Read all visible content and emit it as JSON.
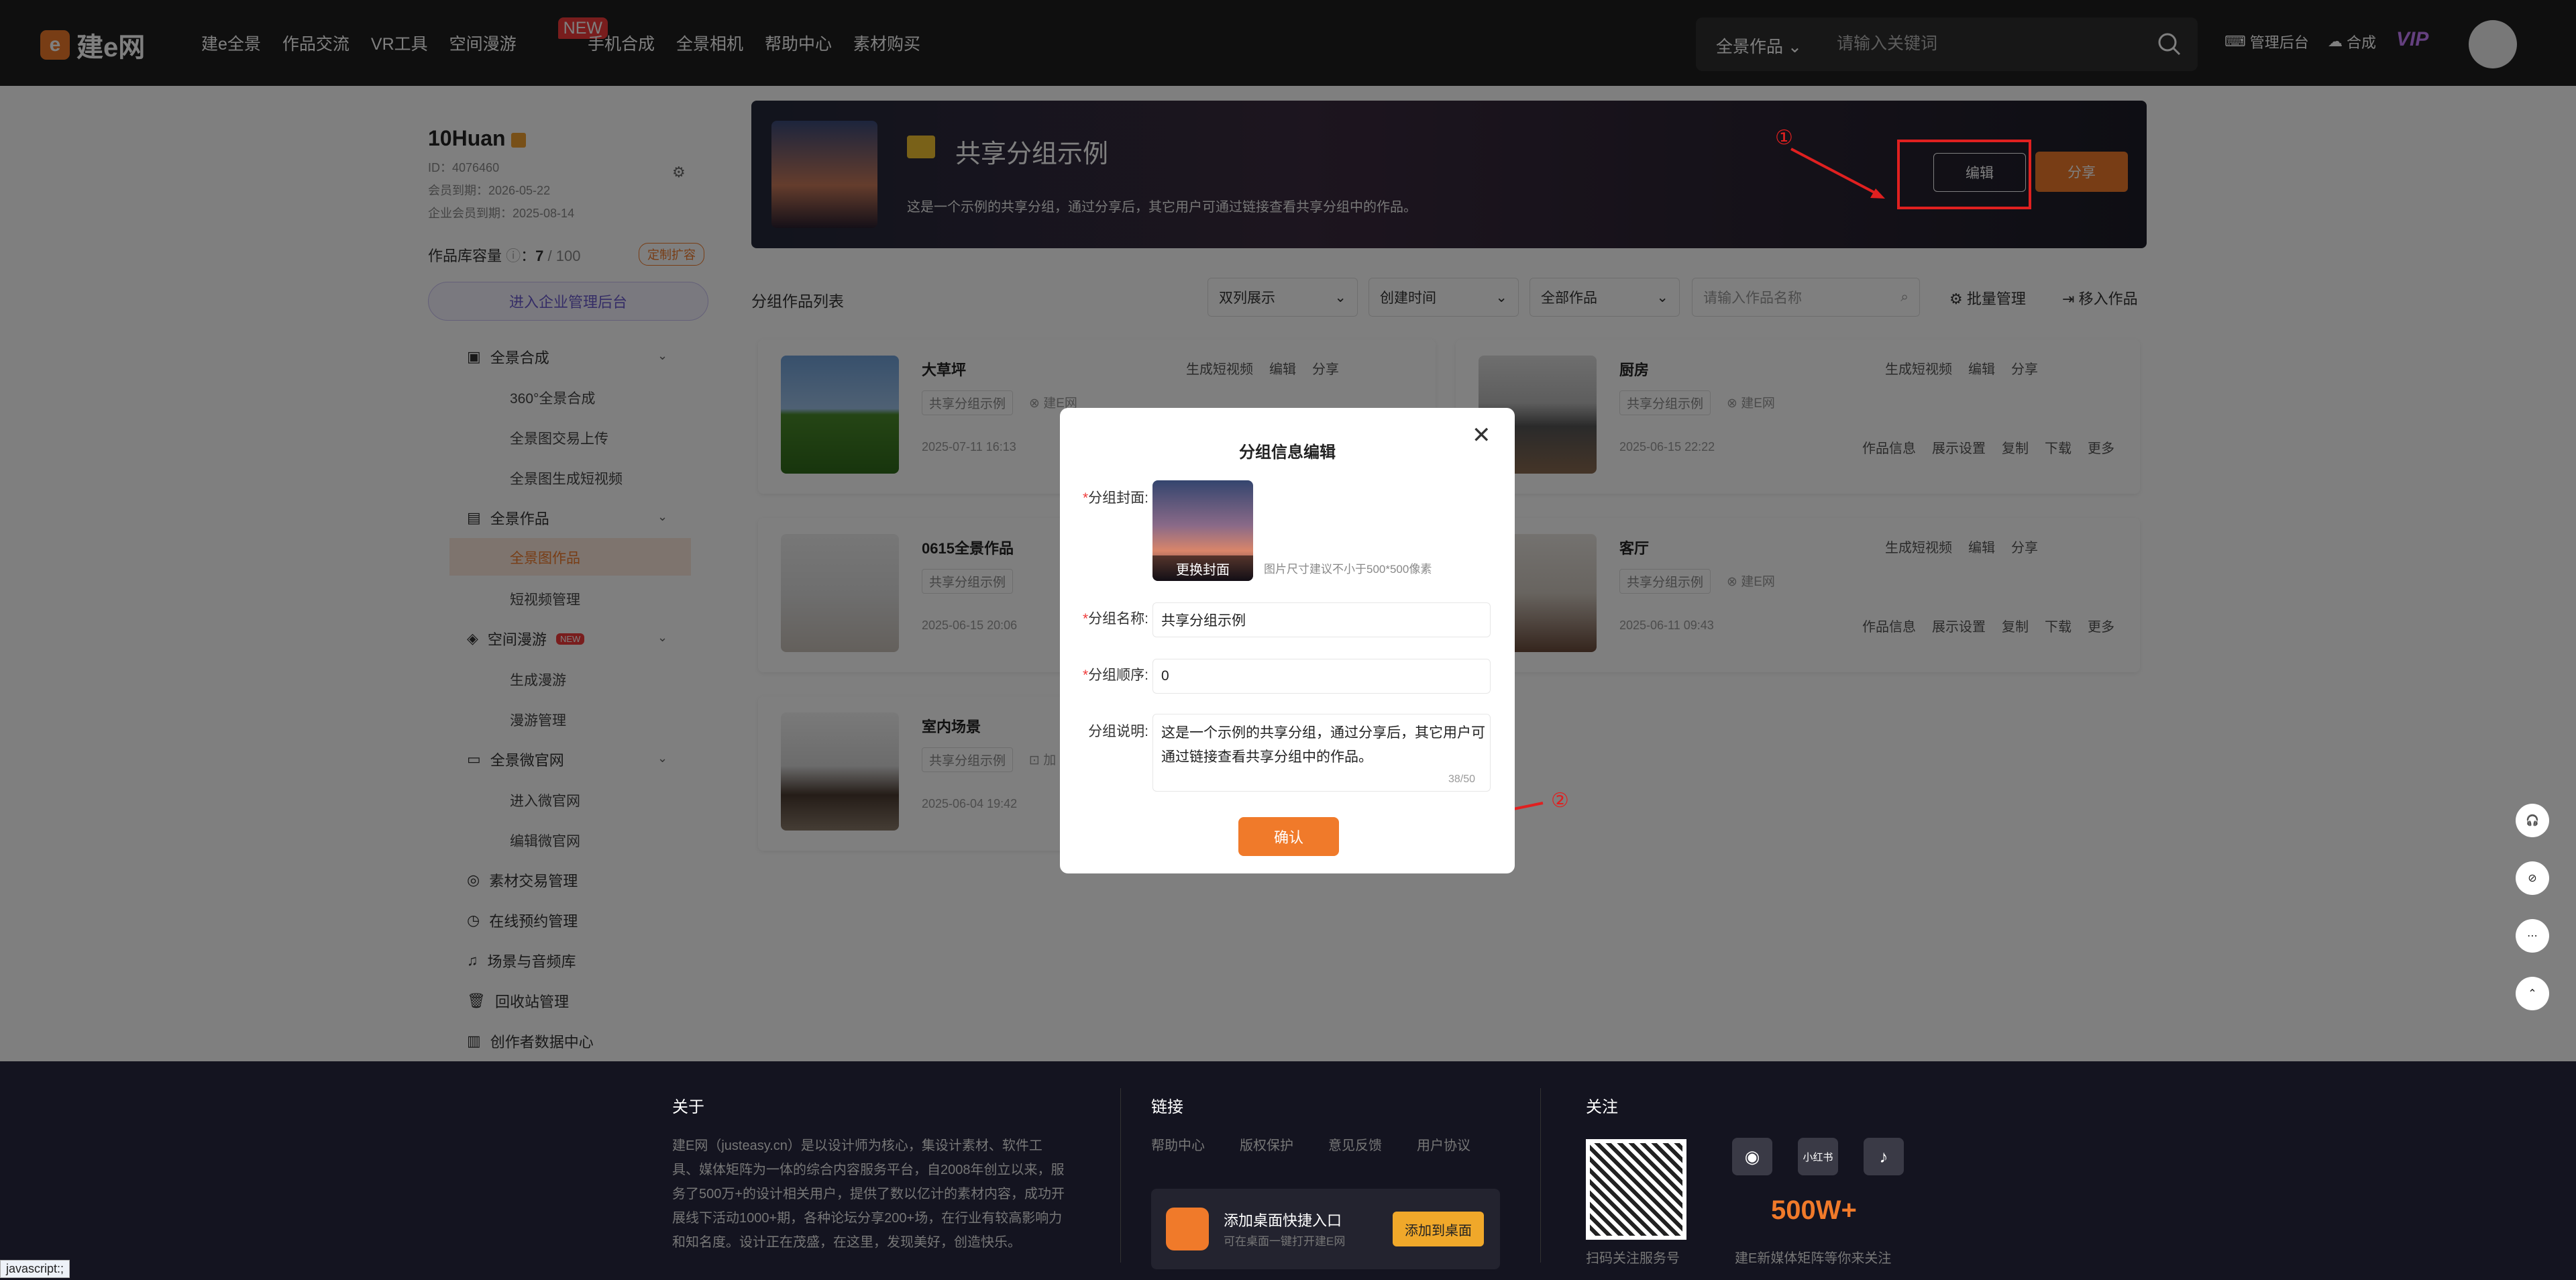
{
  "header": {
    "logo_mark": "e",
    "logo_text": "建e网",
    "nav": [
      "建e全景",
      "作品交流",
      "VR工具",
      "空间漫游",
      "手机合成",
      "全景相机",
      "帮助中心",
      "素材购买"
    ],
    "new_badge": "NEW",
    "search_category": "全景作品",
    "search_placeholder": "请输入关键词",
    "admin_label": "管理后台",
    "compose_label": "合成",
    "vip_label": "VIP"
  },
  "sidebar": {
    "username": "10Huan",
    "id": "ID：4076460",
    "member_expire": "会员到期：2026-05-22",
    "enterprise_expire": "企业会员到期：2025-08-14",
    "capacity_label": "作品库容量",
    "capacity_used": "7",
    "capacity_total": "/ 100",
    "expand_label": "定制扩容",
    "enterprise_button": "进入企业管理后台",
    "menu": [
      {
        "label": "全景合成",
        "children": [
          "360°全景合成",
          "全景图交易上传",
          "全景图生成短视频"
        ]
      },
      {
        "label": "全景作品",
        "children": [
          "全景图作品",
          "短视频管理"
        ]
      },
      {
        "label": "空间漫游",
        "children": [
          "生成漫游",
          "漫游管理"
        ]
      },
      {
        "label": "全景微官网",
        "children": [
          "进入微官网",
          "编辑微官网"
        ]
      },
      {
        "label": "素材交易管理"
      },
      {
        "label": "在线预约管理"
      },
      {
        "label": "场景与音频库"
      },
      {
        "label": "回收站管理"
      },
      {
        "label": "创作者数据中心"
      }
    ]
  },
  "banner": {
    "title": "共享分组示例",
    "description": "这是一个示例的共享分组，通过分享后，其它用户可通过链接查看共享分组中的作品。",
    "edit_button": "编辑",
    "share_button": "分享",
    "annotation_1": "①"
  },
  "toolbar": {
    "list_title": "分组作品列表",
    "view_select": "双列展示",
    "sort_select": "创建时间",
    "filter_select": "全部作品",
    "search_placeholder": "请输入作品名称",
    "batch_label": "批量管理",
    "move_label": "移入作品"
  },
  "works": [
    {
      "title": "大草坪",
      "tag": "共享分组示例",
      "author": "建E网",
      "date": "2025-07-11 16:13"
    },
    {
      "title": "厨房",
      "tag": "共享分组示例",
      "author": "建E网",
      "date": "2025-06-15 22:22"
    },
    {
      "title": "0615全景作品",
      "tag": "共享分组示例",
      "author": "",
      "date": "2025-06-15 20:06"
    },
    {
      "title": "客厅",
      "tag": "共享分组示例",
      "author": "建E网",
      "date": "2025-06-11 09:43"
    },
    {
      "title": "室内场景",
      "tag": "共享分组示例",
      "author": "加",
      "date": "2025-06-04 19:42"
    }
  ],
  "card_actions": {
    "video": "生成短视频",
    "edit": "编辑",
    "share": "分享"
  },
  "card_actions2": [
    "作品信息",
    "展示设置",
    "复制",
    "下载",
    "更多"
  ],
  "modal": {
    "title": "分组信息编辑",
    "cover_label": "分组封面:",
    "cover_change": "更换封面",
    "cover_hint": "图片尺寸建议不小于500*500像素",
    "name_label": "分组名称:",
    "name_value": "共享分组示例",
    "order_label": "分组顺序:",
    "order_value": "0",
    "desc_label": "分组说明:",
    "desc_value": "这是一个示例的共享分组，通过分享后，其它用户可通过链接查看共享分组中的作品。",
    "desc_count": "38/50",
    "confirm": "确认",
    "required_mark": "*",
    "annotation_2": "②"
  },
  "footer": {
    "about_title": "关于",
    "about_text": "建E网（justeasy.cn）是以设计师为核心，集设计素材、软件工具、媒体矩阵为一体的综合内容服务平台，自2008年创立以来，服务了500万+的设计相关用户，提供了数以亿计的素材内容，成功开展线下活动1000+期，各种论坛分享200+场，在行业有较高影响力和知名度。设计正在茂盛，在这里，发现美好，创造快乐。",
    "links_title": "链接",
    "links": [
      "帮助中心",
      "版权保护",
      "意见反馈",
      "用户协议"
    ],
    "desktop_title": "添加桌面快捷入口",
    "desktop_sub": "可在桌面一键打开建E网",
    "desktop_button": "添加到桌面",
    "follow_title": "关注",
    "qr_caption": "扫码关注服务号",
    "fans": "500W+",
    "fans_caption": "建E新媒体矩阵等你来关注",
    "social_xhs": "小红书"
  },
  "status_bar": "javascript:;",
  "colors": {
    "accent": "#f07a2a",
    "annotation": "#e02020",
    "topbar": "#1f1f1f",
    "footer": "#141420"
  }
}
